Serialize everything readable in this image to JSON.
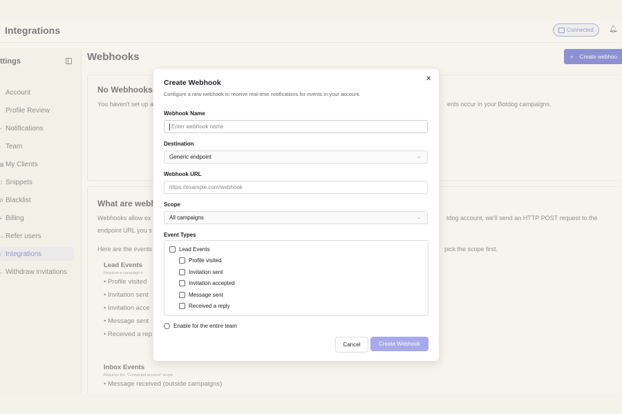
{
  "app": {
    "title": "Integrations",
    "connected_label": "Connected"
  },
  "sidebar": {
    "heading": "ttings",
    "items": [
      {
        "label": "Account",
        "icon": "user-icon",
        "glyph": "˚"
      },
      {
        "label": "Profile Review",
        "icon": "profile-review-icon",
        "glyph": "∶"
      },
      {
        "label": "Notifications",
        "icon": "bell-icon",
        "glyph": "⌐"
      },
      {
        "label": "Team",
        "icon": "team-icon",
        "glyph": "•"
      },
      {
        "label": "My Clients",
        "icon": "clients-icon",
        "glyph": "▤"
      },
      {
        "label": "Snippets",
        "icon": "snippet-icon",
        "glyph": "□"
      },
      {
        "label": "Blacklist",
        "icon": "blacklist-icon",
        "glyph": "⊘"
      },
      {
        "label": "Billing",
        "icon": "billing-icon",
        "glyph": "≡"
      },
      {
        "label": "Refer users",
        "icon": "refer-icon",
        "glyph": "→"
      },
      {
        "label": "Integrations",
        "icon": "integrations-icon",
        "glyph": "⌇",
        "active": true
      },
      {
        "label": "Withdraw invitations",
        "icon": "withdraw-icon",
        "glyph": "←"
      }
    ]
  },
  "main": {
    "title": "Webhooks",
    "create_button": "Create webhoo",
    "empty": {
      "heading": "No Webhooks",
      "text_left": "You haven't set up a",
      "text_right": "ents occur in your Botdog campaigns."
    },
    "about": {
      "heading": "What are webh",
      "line1_left": "Webhooks allow ex",
      "line1_right": "tdog account, we'll send an HTTP POST request to the",
      "line2_left": "endpoint URL you s",
      "events_left": "Here are the events",
      "events_right": "pick the scope first.",
      "lead_title": "Lead Events",
      "lead_req": "Requires a campaign s",
      "lead_items": [
        "Profile visited",
        "Invitation sent",
        "Invitation acce",
        "Message sent",
        "Received a rep"
      ],
      "inbox_title": "Inbox Events",
      "inbox_req": "Requires the \"Connected account\" scope",
      "inbox_items": [
        "Message received (outside campaigns)"
      ]
    }
  },
  "modal": {
    "title": "Create Webhook",
    "subtitle": "Configure a new webhook to receive real-time notifications for events in your account.",
    "name_label": "Webhook Name",
    "name_placeholder": "Enter webhook name",
    "destination_label": "Destination",
    "destination_value": "Generic endpoint",
    "url_label": "Webhook URL",
    "url_placeholder": "https://example.com/webhook",
    "scope_label": "Scope",
    "scope_value": "All campaigns",
    "event_types_label": "Event Types",
    "lead_events_label": "Lead Events",
    "events": [
      "Profile visited",
      "Invitation sent",
      "Invitation accepted",
      "Message sent",
      "Received a reply"
    ],
    "team_label": "Enable for the entire team",
    "cancel_label": "Cancel",
    "submit_label": "Create Webhook"
  }
}
